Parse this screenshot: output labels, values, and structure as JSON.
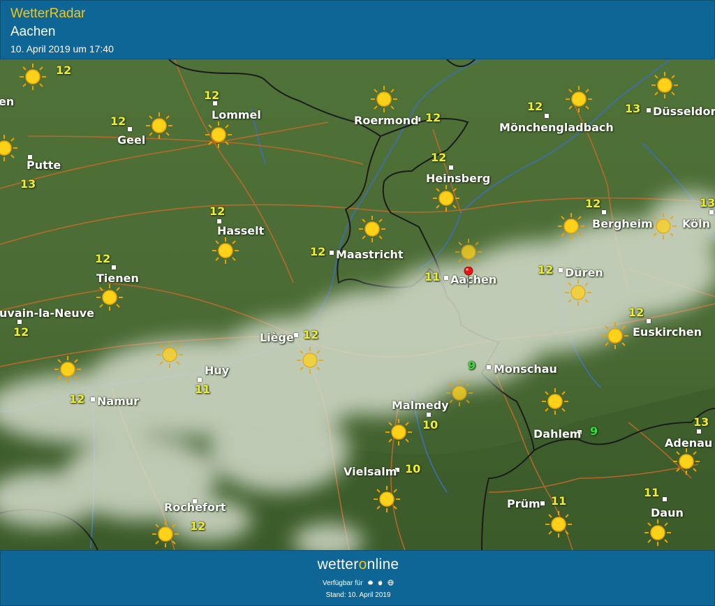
{
  "header": {
    "app_title": "WetterRadar",
    "location": "Aachen",
    "timestamp": "10. April 2019 um 17:40"
  },
  "colors": {
    "header_bg": "#0d6695",
    "title_yellow": "#f7c514",
    "map_green": "#4d6e37",
    "temp_yellow": "#f0f02a",
    "temp_green": "#33e03a",
    "border_line": "#1b1b1b",
    "road_line": "#c86a2a",
    "river_line": "#3e6fa8"
  },
  "map": {
    "selected_location": "Aachen",
    "weather_icon": "sun-icon",
    "cities": [
      {
        "name": "Lommel",
        "id": "lommel"
      },
      {
        "name": "Geel",
        "id": "geel"
      },
      {
        "name": "Putte",
        "id": "putte"
      },
      {
        "name": "Hasselt",
        "id": "hasselt"
      },
      {
        "name": "Tienen",
        "id": "tienen"
      },
      {
        "name": "uvain-la-Neuve",
        "id": "louvain"
      },
      {
        "name": "Liège",
        "id": "liege"
      },
      {
        "name": "Huy",
        "id": "huy"
      },
      {
        "name": "Namur",
        "id": "namur"
      },
      {
        "name": "Rochefort",
        "id": "rochefort"
      },
      {
        "name": "Roermond",
        "id": "roermond"
      },
      {
        "name": "Maastricht",
        "id": "maastricht"
      },
      {
        "name": "Heinsberg",
        "id": "heinsberg"
      },
      {
        "name": "Aachen",
        "id": "aachen"
      },
      {
        "name": "Mönchengladbach",
        "id": "mgladbach"
      },
      {
        "name": "Düsseldorf",
        "id": "duesseldorf"
      },
      {
        "name": "Bergheim",
        "id": "bergheim"
      },
      {
        "name": "Köln",
        "id": "koeln"
      },
      {
        "name": "Düren",
        "id": "dueren"
      },
      {
        "name": "Euskirchen",
        "id": "euskirchen"
      },
      {
        "name": "Monschau",
        "id": "monschau"
      },
      {
        "name": "Malmedy",
        "id": "malmedy"
      },
      {
        "name": "Vielsalm",
        "id": "vielsalm"
      },
      {
        "name": "Prüm",
        "id": "pruem"
      },
      {
        "name": "Dahlem",
        "id": "dahlem"
      },
      {
        "name": "Adenau",
        "id": "adenau"
      },
      {
        "name": "Daun",
        "id": "daun"
      },
      {
        "name": "en",
        "id": "edge-left"
      }
    ],
    "temperatures": [
      {
        "id": "t1",
        "value": "12"
      },
      {
        "id": "t2",
        "value": "12"
      },
      {
        "id": "t3",
        "value": "12"
      },
      {
        "id": "t4",
        "value": "13"
      },
      {
        "id": "t5",
        "value": "12"
      },
      {
        "id": "t6",
        "value": "12"
      },
      {
        "id": "t7",
        "value": "12"
      },
      {
        "id": "t8",
        "value": "12"
      },
      {
        "id": "t9",
        "value": "11"
      },
      {
        "id": "t10",
        "value": "12"
      },
      {
        "id": "t11",
        "value": "12"
      },
      {
        "id": "t12",
        "value": "12"
      },
      {
        "id": "t13",
        "value": "12"
      },
      {
        "id": "t14",
        "value": "12"
      },
      {
        "id": "t15",
        "value": "11"
      },
      {
        "id": "t16",
        "value": "12"
      },
      {
        "id": "t17",
        "value": "13"
      },
      {
        "id": "t18",
        "value": "12"
      },
      {
        "id": "t19",
        "value": "13"
      },
      {
        "id": "t20",
        "value": "12"
      },
      {
        "id": "t21",
        "value": "12"
      },
      {
        "id": "t22",
        "value": "9"
      },
      {
        "id": "t23",
        "value": "10"
      },
      {
        "id": "t24",
        "value": "10"
      },
      {
        "id": "t25",
        "value": "11"
      },
      {
        "id": "t26",
        "value": "9"
      },
      {
        "id": "t27",
        "value": "13"
      },
      {
        "id": "t28",
        "value": "11"
      }
    ]
  },
  "footer": {
    "brand_prefix": "wetter",
    "brand_o": "o",
    "brand_suffix": "nline",
    "available_label": "Verfügbar für",
    "available_icons": [
      "android-icon",
      "apple-icon",
      "web-icon"
    ],
    "stand": "Stand: 10. April 2019"
  }
}
